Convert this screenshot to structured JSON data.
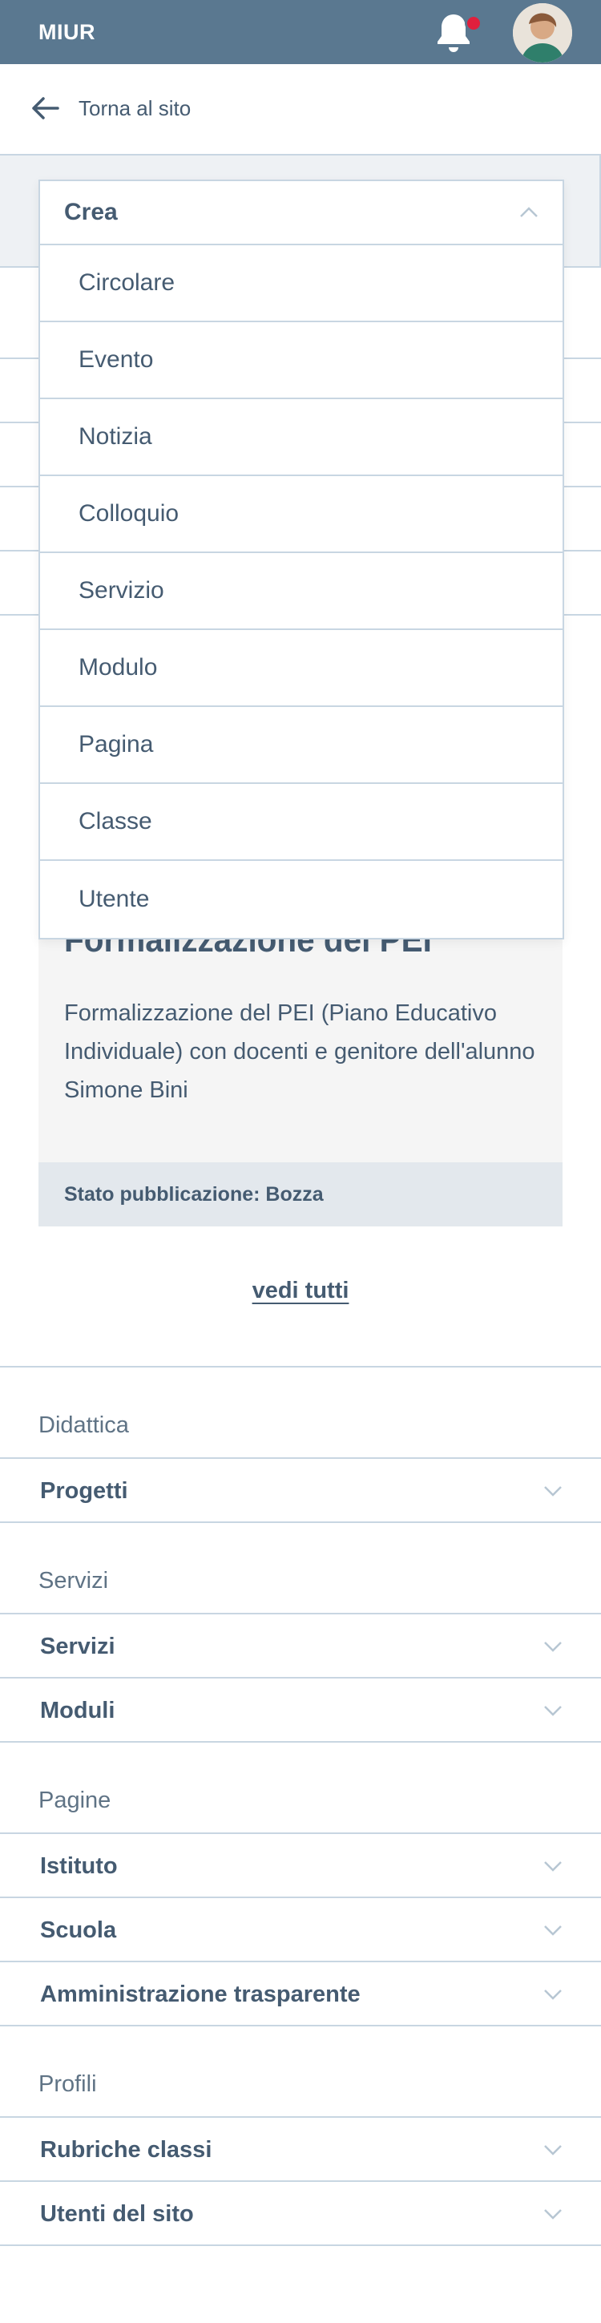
{
  "header": {
    "brand": "MIUR",
    "colors": {
      "bar": "#5a7890",
      "notification_dot": "#e0203d"
    },
    "icons": [
      "bell-icon",
      "avatar"
    ]
  },
  "back": {
    "label": "Torna al sito",
    "icon": "arrow-left-icon"
  },
  "create_dropdown": {
    "label": "Crea",
    "icon": "chevron-up-icon",
    "items": [
      "Circolare",
      "Evento",
      "Notizia",
      "Colloquio",
      "Servizio",
      "Modulo",
      "Pagina",
      "Classe",
      "Utente"
    ]
  },
  "card": {
    "title": "Formalizzazione del PEI",
    "description": "Formalizzazione del PEI (Piano Educativo Individuale) con docenti e genitore dell'alunno Simone Bini",
    "status": "Stato pubblicazione: Bozza"
  },
  "see_all": "vedi tutti",
  "menu": {
    "sections": [
      {
        "label": "Didattica",
        "items": [
          "Progetti"
        ]
      },
      {
        "label": "Servizi",
        "items": [
          "Servizi",
          "Moduli"
        ]
      },
      {
        "label": "Pagine",
        "items": [
          "Istituto",
          "Scuola",
          "Amministrazione trasparente"
        ]
      },
      {
        "label": "Profili",
        "items": [
          "Rubriche classi",
          "Utenti del sito"
        ]
      }
    ],
    "item_icon": "chevron-down-icon"
  }
}
